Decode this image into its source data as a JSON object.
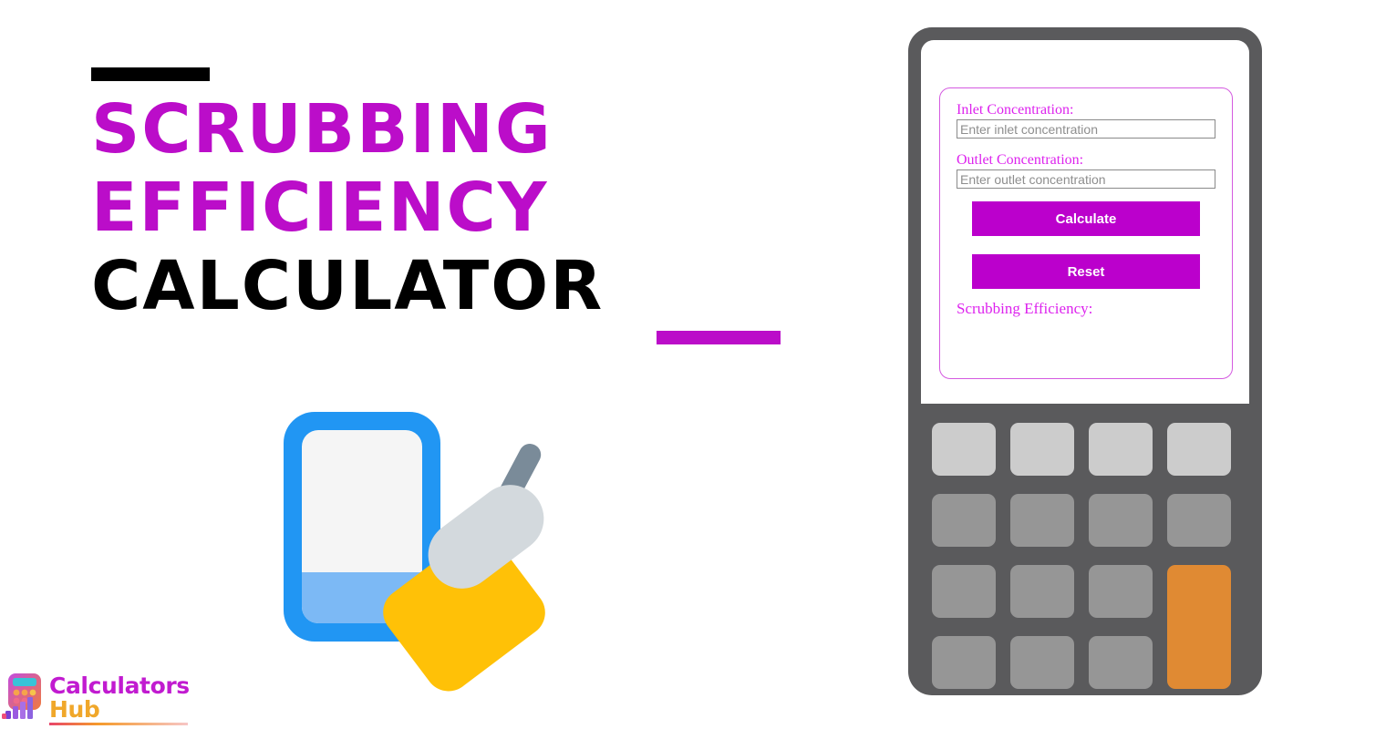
{
  "page": {
    "background_color": "#ffffff",
    "accent_magenta": "#bb0dc9",
    "accent_orange": "#e08a33",
    "device_body_color": "#5a5a5c"
  },
  "title": {
    "line1": "SCRUBBING",
    "line2": "EFFICIENCY",
    "line3": "CALCULATOR",
    "line1_color": "#bb0dc9",
    "line2_color": "#bb0dc9",
    "line3_color": "#000000",
    "top_rule_color": "#000000",
    "bottom_rule_color": "#bb0dc9"
  },
  "illustration": {
    "name": "phone-with-scrub-brush",
    "phone_frame_color": "#2196f3",
    "phone_screen_color": "#f5f5f5",
    "phone_band_color": "#7cb9f5",
    "brush_handle_color": "#7a8b99",
    "brush_head_color": "#d3d9dd",
    "brush_bristles_color": "#ffc107"
  },
  "brand": {
    "word1": "Calculators",
    "word2": "Hub",
    "word1_color": "#c11bd0",
    "word2_color": "#f0a72a",
    "mark": "calculator-bar-chart-icon"
  },
  "calculator": {
    "form": {
      "border_color": "#d45ae0",
      "fields": [
        {
          "name": "inlet-concentration",
          "label": "Inlet Concentration:",
          "placeholder": "Enter inlet concentration",
          "value": ""
        },
        {
          "name": "outlet-concentration",
          "label": "Outlet Concentration:",
          "placeholder": "Enter outlet concentration",
          "value": ""
        }
      ],
      "buttons": {
        "calculate": "Calculate",
        "reset": "Reset",
        "background_color": "#bb00cc",
        "text_color": "#ffffff"
      },
      "result": {
        "label": "Scrubbing Efficiency:",
        "value": ""
      }
    },
    "keypad": {
      "rows": 4,
      "columns": 4,
      "light_key_color": "#cccccc",
      "medium_key_color": "#969696",
      "accent_key_color": "#e08a33"
    }
  }
}
